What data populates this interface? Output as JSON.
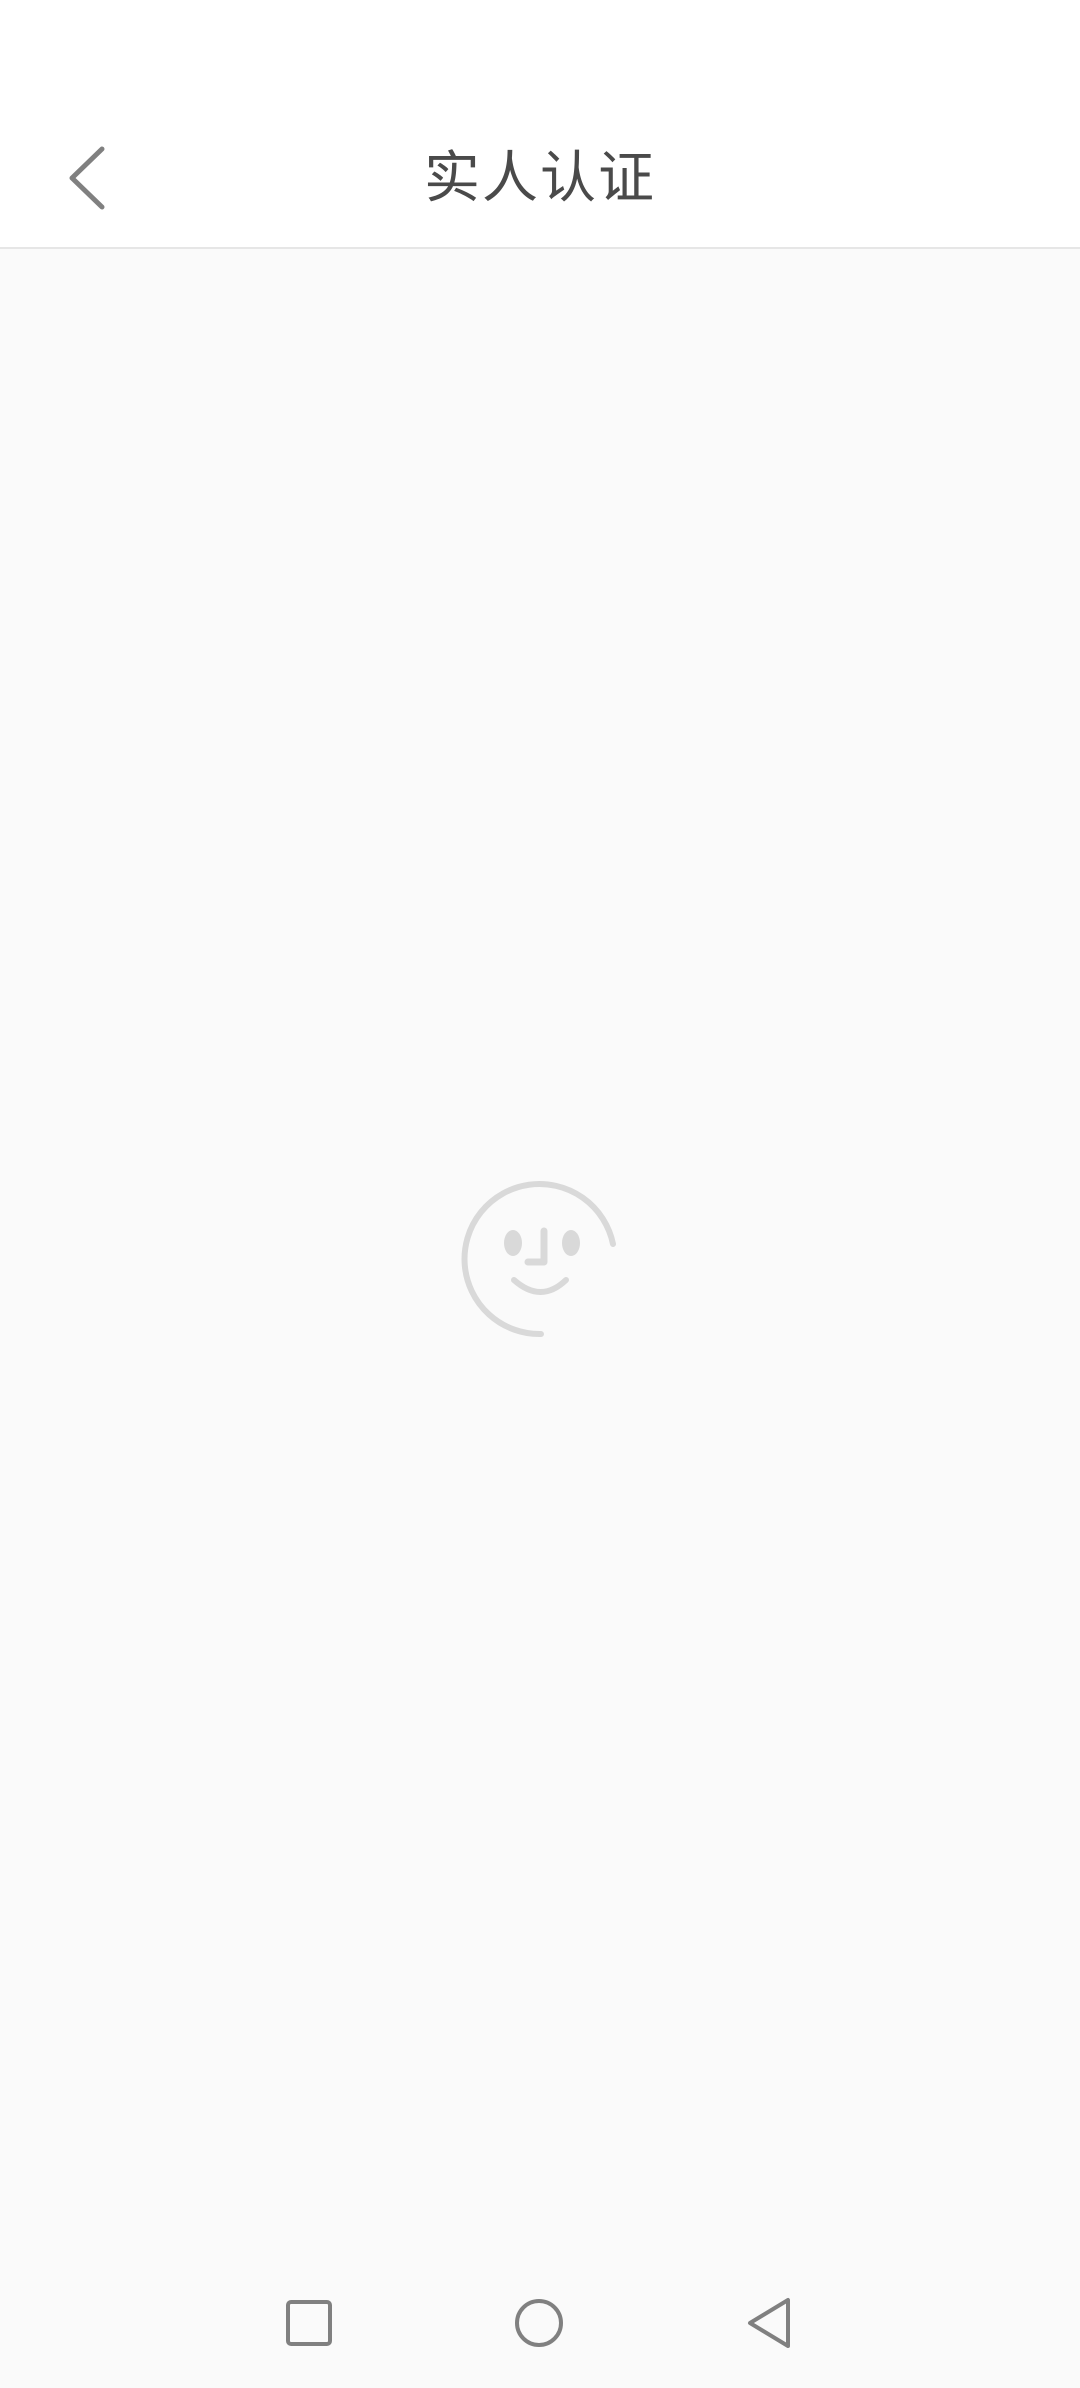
{
  "header": {
    "title": "实人认证",
    "back_icon": "chevron-left-icon"
  },
  "content": {
    "loading_icon": "face-loading-icon"
  },
  "navigation": {
    "recents_icon": "square-icon",
    "home_icon": "circle-icon",
    "back_icon": "triangle-back-icon"
  },
  "colors": {
    "background": "#fafafa",
    "header_bg": "#ffffff",
    "title_text": "#4a4a4a",
    "icon_gray": "#808080",
    "face_gray": "#d9d9d9",
    "divider": "#e6e6e6"
  }
}
